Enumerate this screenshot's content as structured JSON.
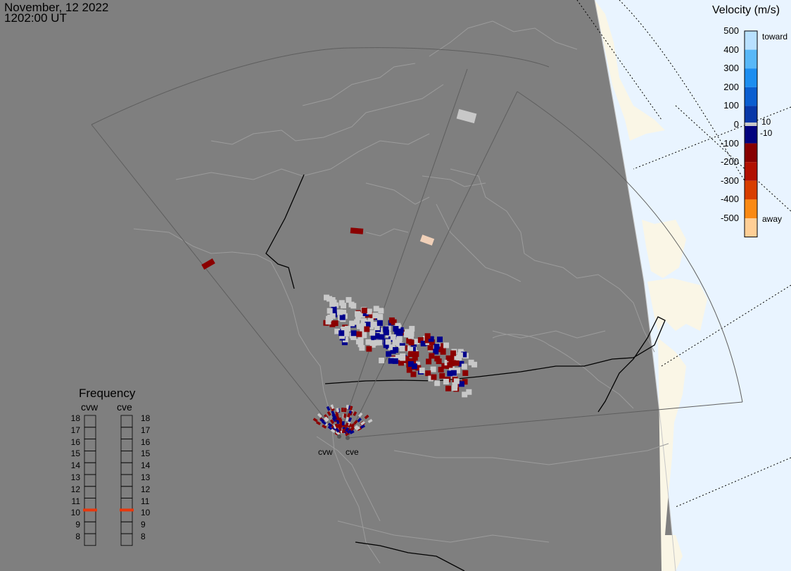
{
  "header": {
    "date": "November, 12 2022",
    "time": "1202:00 UT"
  },
  "velocity_scale": {
    "title": "Velocity (m/s)",
    "ticks": [
      "500",
      "400",
      "300",
      "200",
      "100",
      "0",
      "-100",
      "-200",
      "-300",
      "-400",
      "-500"
    ],
    "toward_label": "toward",
    "away_label": "away",
    "threshold_pos": "10",
    "threshold_neg": "-10",
    "colors": [
      "#b8e0ff",
      "#58b8f8",
      "#1c8ef0",
      "#0a5ed0",
      "#0838a8",
      "#02037e",
      "#870000",
      "#b11000",
      "#d83e00",
      "#fa8a14",
      "#ffcf96"
    ]
  },
  "frequency_panel": {
    "title": "Frequency",
    "radars": [
      "cvw",
      "cve"
    ],
    "levels": [
      "18",
      "17",
      "16",
      "15",
      "14",
      "13",
      "12",
      "11",
      "10",
      "9",
      "8"
    ],
    "cvw_frequency": 11,
    "cve_frequency": 11,
    "marker_color": "#e8380d"
  },
  "radar_labels": {
    "west": "cvw",
    "east": "cve"
  },
  "colors": {
    "background": "#7f7f7f",
    "ocean": "#e9f4ff",
    "land_lit": "#faf6e6",
    "echo_red": "#8b0000",
    "echo_blue": "#00008b",
    "echo_grey": "#c8c8c8"
  }
}
